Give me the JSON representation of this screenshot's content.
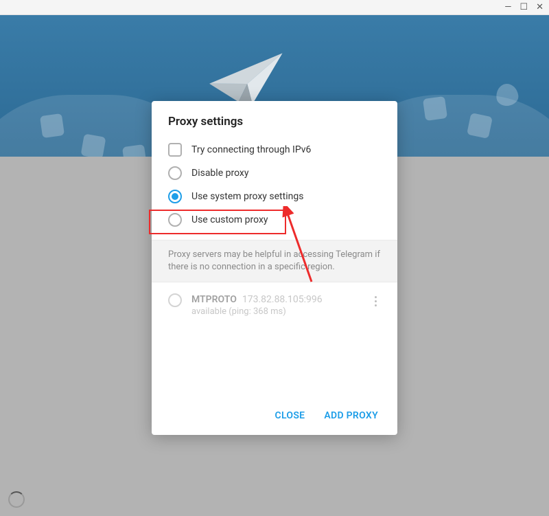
{
  "window": {
    "minimize": "—",
    "maximize": "☐",
    "close": "✕"
  },
  "dialog": {
    "title": "Proxy settings",
    "options": {
      "ipv6": "Try connecting through IPv6",
      "disable": "Disable proxy",
      "system": "Use system proxy settings",
      "custom": "Use custom proxy"
    },
    "info": "Proxy servers may be helpful in accessing Telegram if there is no connection in a specific region.",
    "proxies": [
      {
        "name": "MTPROTO",
        "address": "173.82.88.105:996",
        "status": "available (ping: 368 ms)"
      }
    ],
    "buttons": {
      "close": "CLOSE",
      "add": "ADD PROXY"
    }
  }
}
